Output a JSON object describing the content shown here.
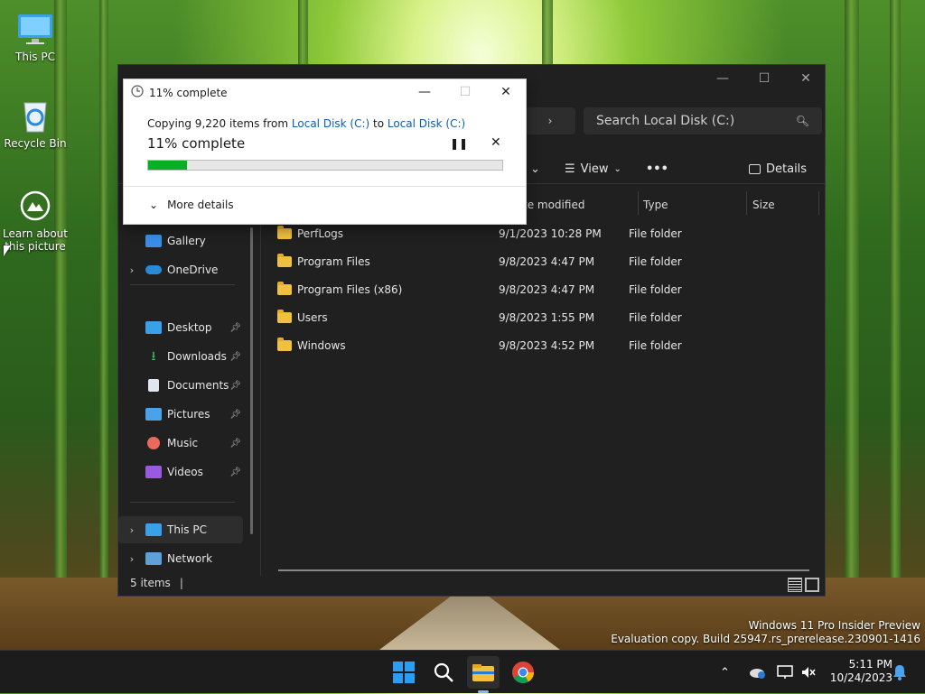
{
  "desktop": {
    "icons": [
      {
        "label": "This PC"
      },
      {
        "label": "Recycle Bin"
      },
      {
        "label": "Learn about this picture"
      }
    ],
    "watermark": {
      "line1": "Windows 11 Pro Insider Preview",
      "line2": "Evaluation copy. Build 25947.rs_prerelease.230901-1416"
    }
  },
  "explorer": {
    "search_placeholder": "Search Local Disk (C:)",
    "toolbar": {
      "view_label": "View",
      "details_label": "Details",
      "more_label": "•••"
    },
    "columns": {
      "date": "te modified",
      "type": "Type",
      "size": "Size"
    },
    "sidebar": {
      "items": [
        {
          "label": "Gallery"
        },
        {
          "label": "OneDrive"
        },
        {
          "label": "Desktop"
        },
        {
          "label": "Downloads"
        },
        {
          "label": "Documents"
        },
        {
          "label": "Pictures"
        },
        {
          "label": "Music"
        },
        {
          "label": "Videos"
        },
        {
          "label": "This PC"
        },
        {
          "label": "Network"
        }
      ]
    },
    "rows": [
      {
        "name": "PerfLogs",
        "date": "9/1/2023 10:28 PM",
        "type": "File folder"
      },
      {
        "name": "Program Files",
        "date": "9/8/2023 4:47 PM",
        "type": "File folder"
      },
      {
        "name": "Program Files (x86)",
        "date": "9/8/2023 4:47 PM",
        "type": "File folder"
      },
      {
        "name": "Users",
        "date": "9/8/2023 1:55 PM",
        "type": "File folder"
      },
      {
        "name": "Windows",
        "date": "9/8/2023 4:52 PM",
        "type": "File folder"
      }
    ],
    "status": "5 items"
  },
  "copy_dialog": {
    "title": "11% complete",
    "line_prefix": "Copying 9,220 items from ",
    "source": "Local Disk (C:)",
    "to_word": " to ",
    "destination": "Local Disk (C:)",
    "percent_label": "11% complete",
    "progress_fraction": 0.11,
    "more_details": "More details",
    "progress_color": "#06b025"
  },
  "taskbar": {
    "time": "5:11 PM",
    "date": "10/24/2023"
  },
  "colors": {
    "accent_link": "#0b5cad",
    "windows_blue": "#0078d4"
  }
}
